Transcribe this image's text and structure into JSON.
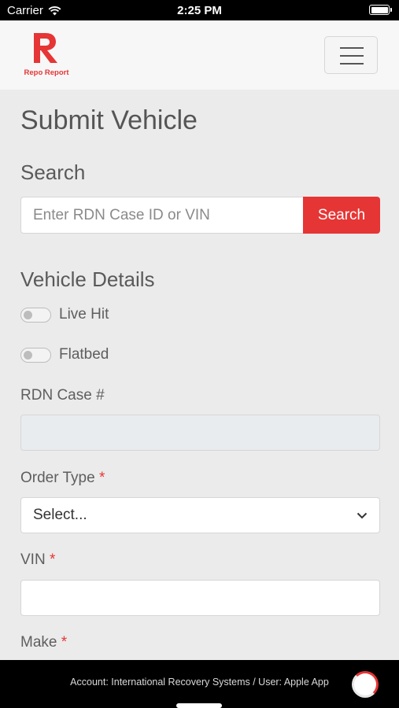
{
  "status_bar": {
    "carrier": "Carrier",
    "time": "2:25 PM"
  },
  "brand": {
    "name": "Repo Report",
    "accent": "#e63535"
  },
  "page": {
    "title": "Submit Vehicle"
  },
  "search": {
    "heading": "Search",
    "placeholder": "Enter RDN Case ID or VIN",
    "button_label": "Search"
  },
  "vehicle_details": {
    "heading": "Vehicle Details",
    "toggles": [
      {
        "label": "Live Hit",
        "on": false
      },
      {
        "label": "Flatbed",
        "on": false
      }
    ],
    "rdn_case": {
      "label": "RDN Case #",
      "value": ""
    },
    "order_type": {
      "label": "Order Type",
      "required_mark": "*",
      "selected": "Select..."
    },
    "vin": {
      "label": "VIN",
      "required_mark": "*",
      "value": ""
    },
    "make": {
      "label": "Make",
      "required_mark": "*"
    }
  },
  "footer": {
    "text": "Account: International Recovery Systems / User: Apple App"
  }
}
